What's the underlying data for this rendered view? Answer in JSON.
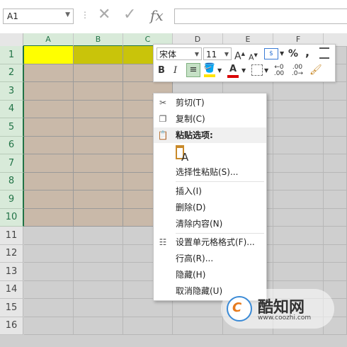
{
  "formula_bar": {
    "name_box": "A1",
    "separator": "⋮",
    "cancel_glyph": "✕",
    "enter_glyph": "✓",
    "function_glyph": "fx"
  },
  "columns": [
    "A",
    "B",
    "C",
    "D",
    "E",
    "F"
  ],
  "rows": [
    "1",
    "2",
    "3",
    "4",
    "5",
    "6",
    "7",
    "8",
    "9",
    "10",
    "11",
    "12",
    "13",
    "14",
    "15",
    "16"
  ],
  "colors": {
    "yellow_fill": "#FFFF00",
    "olive_fill": "#C9C40A",
    "tan_fill": "#C9B9A9",
    "excel_green": "#217346",
    "font_color_red": "#D90000",
    "highlight_yellow": "#FFE400"
  },
  "mini_toolbar": {
    "font_name": "宋体",
    "font_size": "11",
    "grow_font": "A",
    "shrink_font": "A",
    "percent": "%",
    "comma": ",",
    "bold": "B",
    "italic": "I",
    "font_color": "A",
    "decimal_increase": ".00",
    "decimal_decrease": ".0"
  },
  "context_menu": {
    "cut": "剪切(T)",
    "copy": "复制(C)",
    "paste_options": "粘贴选项:",
    "paste_special": "选择性粘贴(S)...",
    "insert": "插入(I)",
    "delete": "删除(D)",
    "clear_contents": "清除内容(N)",
    "format_cells": "设置单元格格式(F)...",
    "row_height": "行高(R)...",
    "hide": "隐藏(H)",
    "unhide": "取消隐藏(U)"
  },
  "watermark": {
    "logo_text": "C",
    "title": "酷知网",
    "url": "www.coozhi.com"
  }
}
